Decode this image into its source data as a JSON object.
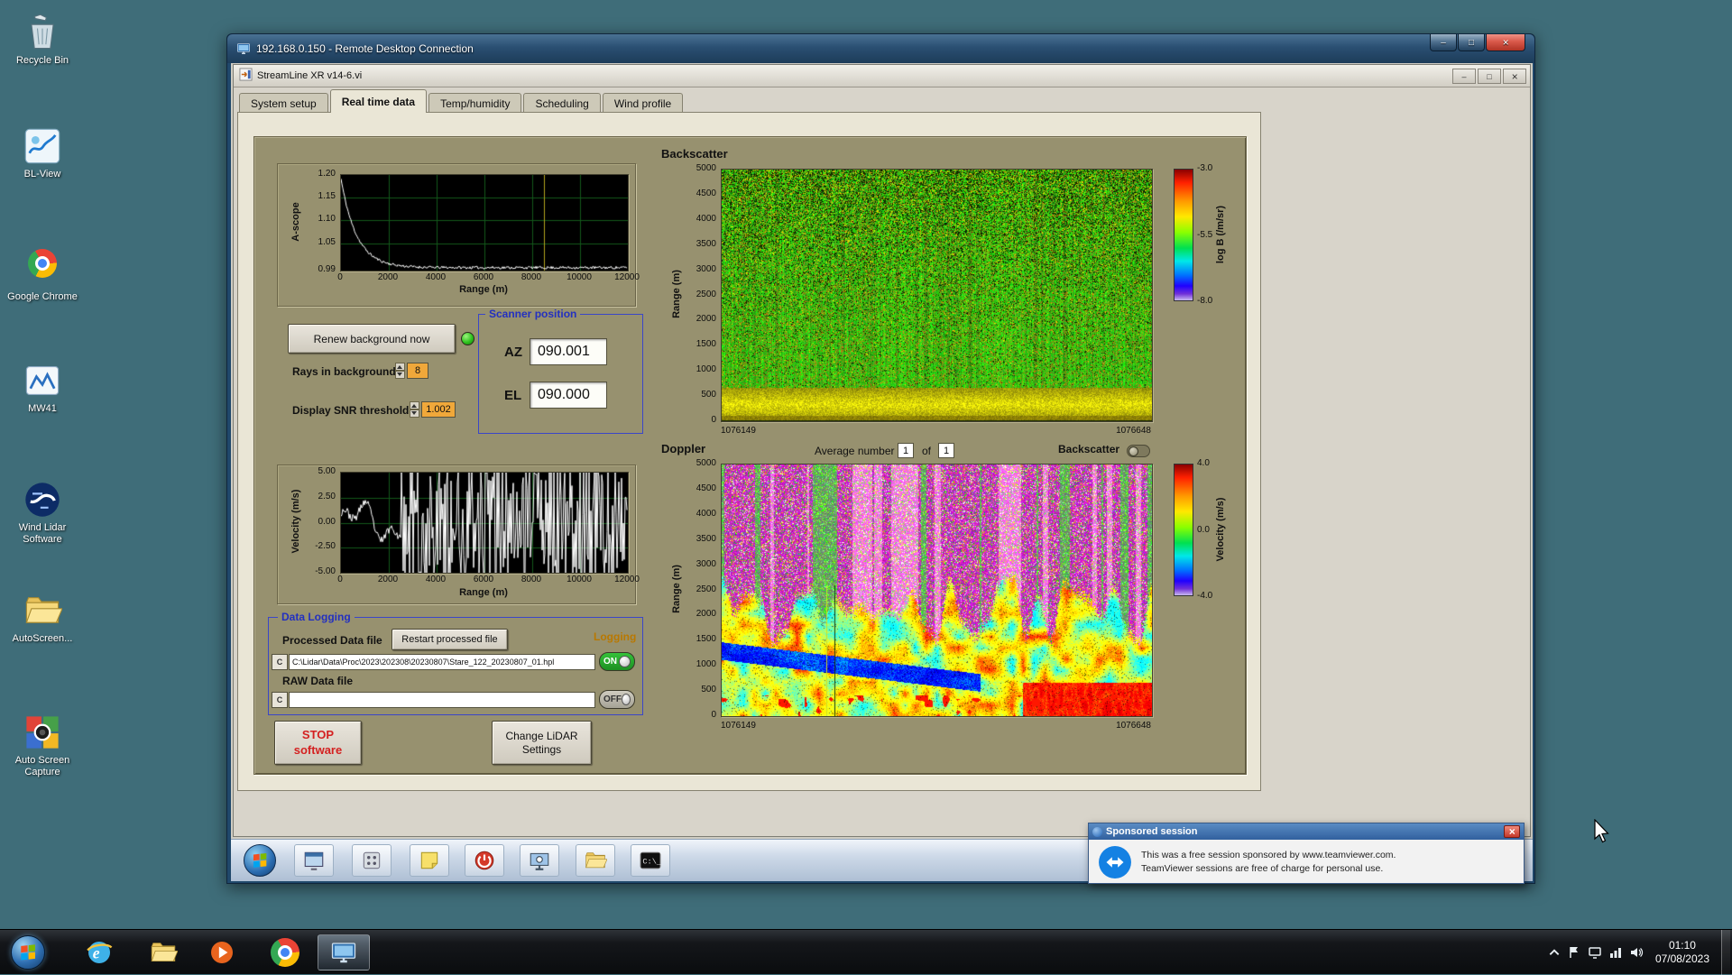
{
  "desktop": {
    "icons": [
      {
        "id": "recycle-bin",
        "label": "Recycle Bin"
      },
      {
        "id": "bl-view",
        "label": "BL-View"
      },
      {
        "id": "chrome",
        "label": "Google Chrome"
      },
      {
        "id": "mw41",
        "label": "MW41"
      },
      {
        "id": "wind-lidar",
        "label": "Wind Lidar Software"
      },
      {
        "id": "folder",
        "label": "AutoScreen..."
      },
      {
        "id": "auto-screen-capture",
        "label": "Auto Screen Capture"
      }
    ]
  },
  "rdp_window": {
    "title": "192.168.0.150 - Remote Desktop Connection"
  },
  "app_window": {
    "title": "StreamLine XR v14-6.vi",
    "tabs": [
      "System setup",
      "Real time data",
      "Temp/humidity",
      "Scheduling",
      "Wind profile"
    ],
    "active_tab": "Real time data"
  },
  "panel": {
    "renew_button": "Renew background now",
    "rays_label": "Rays in background",
    "rays_value": "8",
    "snr_label": "Display SNR threshold",
    "snr_value": "1.002",
    "scanner": {
      "title": "Scanner position",
      "az_label": "AZ",
      "az_value": "090.001",
      "el_label": "EL",
      "el_value": "090.000"
    },
    "average_label": "Average number",
    "average_value": "1",
    "of_label": "of",
    "of_count": "1",
    "backscatter_toggle_label": "Backscatter",
    "logging": {
      "title": "Data Logging",
      "processed_label": "Processed Data file",
      "restart_button": "Restart processed file",
      "logging_label": "Logging",
      "processed_drive": "C",
      "processed_path": "C:\\Lidar\\Data\\Proc\\2023\\202308\\20230807\\Stare_122_20230807_01.hpl",
      "on_label": "ON",
      "raw_label": "RAW Data file",
      "raw_drive": "C",
      "raw_path": "",
      "off_label": "OFF"
    },
    "stop_line1": "STOP",
    "stop_line2": "software",
    "settings_line1": "Change LiDAR",
    "settings_line2": "Settings"
  },
  "chart_data": [
    {
      "type": "line",
      "name": "a-scope",
      "ylabel": "A-scope",
      "xlabel": "Range (m)",
      "xlim": [
        0,
        12000
      ],
      "ylim": [
        0.99,
        1.2
      ],
      "xticks": [
        0,
        2000,
        4000,
        6000,
        8000,
        10000,
        12000
      ],
      "yticks": [
        "1.20",
        "1.15",
        "1.10",
        "1.05",
        "0.99"
      ],
      "cursor_x": 8500,
      "series": [
        {
          "name": "a-scope-trace",
          "x": [
            0,
            250,
            500,
            750,
            1000,
            1500,
            2000,
            3000,
            4000,
            6000,
            8000,
            10000,
            12000
          ],
          "y": [
            1.19,
            1.16,
            1.12,
            1.08,
            1.05,
            1.02,
            1.005,
            0.999,
            0.998,
            0.997,
            0.997,
            0.996,
            0.996
          ]
        }
      ],
      "grid": true,
      "plot_bg": "#000000",
      "line_color": "#ffffff"
    },
    {
      "type": "heatmap",
      "name": "backscatter",
      "title": "Backscatter",
      "ylabel": "Range (m)",
      "ylim": [
        0,
        5000
      ],
      "yticks": [
        5000,
        4500,
        4000,
        3500,
        3000,
        2500,
        2000,
        1500,
        1000,
        500,
        0
      ],
      "x_start_label": "1076149",
      "x_end_label": "1076648",
      "colorbar": {
        "label": "log B (/m/sr)",
        "ticks": [
          "-3.0",
          "-5.5",
          "-8.0"
        ],
        "max": -3,
        "min": -8
      },
      "description": "Green speckled backscatter field aloft with bright yellow aerosol band below ~700 m"
    },
    {
      "type": "line",
      "name": "velocity",
      "ylabel": "Velocity (m/s)",
      "xlabel": "Range (m)",
      "xlim": [
        0,
        12000
      ],
      "ylim": [
        -5,
        5
      ],
      "xticks": [
        0,
        2000,
        4000,
        6000,
        8000,
        10000,
        12000
      ],
      "yticks": [
        "5.00",
        "2.50",
        "0.00",
        "-2.50",
        "-5.00"
      ],
      "description": "Coherent velocity trace out to ~2500 m, uncorrelated noise spanning ±5 m/s beyond"
    },
    {
      "type": "heatmap",
      "name": "doppler",
      "title": "Doppler",
      "ylabel": "Range (m)",
      "ylim": [
        0,
        5000
      ],
      "yticks": [
        5000,
        4500,
        4000,
        3500,
        3000,
        2500,
        2000,
        1500,
        1000,
        500,
        0
      ],
      "x_start_label": "1076149",
      "x_end_label": "1076648",
      "colorbar": {
        "label": "Velocity (m/s)",
        "ticks": [
          "4.0",
          "0.0",
          "-4.0"
        ],
        "max": 4,
        "min": -4
      },
      "description": "Magenta uncorrelated noise above ~2200 m; coherent green/yellow velocities with blue and red structures below"
    }
  ],
  "popup": {
    "title": "Sponsored session",
    "line1": "This was a free session sponsored by www.teamviewer.com.",
    "line2": "TeamViewer sessions are free of charge for personal use."
  },
  "remote_taskbar": {
    "icons": [
      "window",
      "grid",
      "notes",
      "power",
      "capture",
      "folder",
      "cmd"
    ]
  },
  "host_taskbar": {
    "icons": [
      "ie",
      "explorer",
      "media-player",
      "chrome"
    ],
    "active_app": "remote-desktop",
    "tray_icons": [
      "flag",
      "display",
      "network",
      "volume"
    ],
    "time": "01:10",
    "date": "07/08/2023"
  },
  "colors": {
    "on_green": "#2fae35",
    "stop_red": "#d42020",
    "fieldset_blue": "#2330c0",
    "logging_orange": "#b97800",
    "panel_tan": "#97916f"
  }
}
